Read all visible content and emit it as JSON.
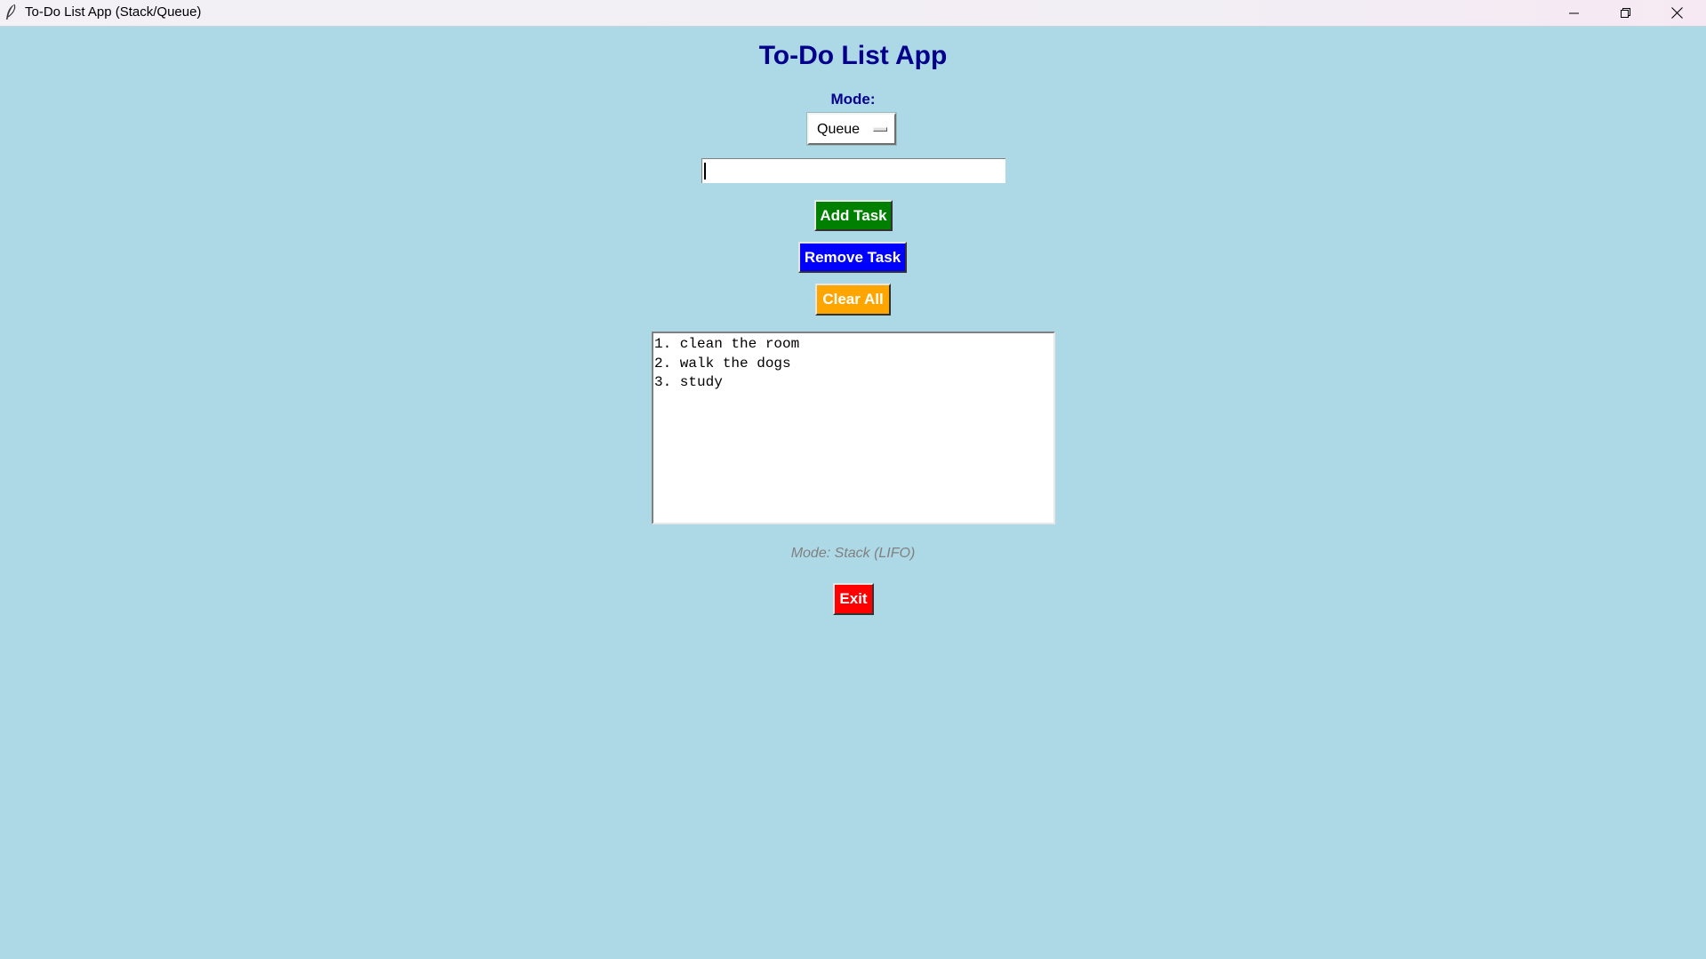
{
  "window": {
    "title": "To-Do List App (Stack/Queue)",
    "icon": "feather-icon",
    "controls": [
      "minimize-icon",
      "restore-icon",
      "close-icon"
    ]
  },
  "app": {
    "title": "To-Do List App",
    "mode_label": "Mode:",
    "mode_selected": "Queue",
    "task_input": {
      "value": "",
      "placeholder": ""
    },
    "buttons": {
      "add": "Add Task",
      "remove": "Remove Task",
      "clear": "Clear All",
      "exit": "Exit"
    },
    "tasks": [
      "1. clean the room",
      "2. walk the dogs",
      "3. study"
    ],
    "status": "Mode: Stack (LIFO)"
  },
  "colors": {
    "background": "#ADD8E6",
    "title_text": "#00008B",
    "add_button": "#008000",
    "remove_button": "#0000FF",
    "clear_button": "#FFA500",
    "exit_button": "#FF0000",
    "status_text": "#808080"
  }
}
